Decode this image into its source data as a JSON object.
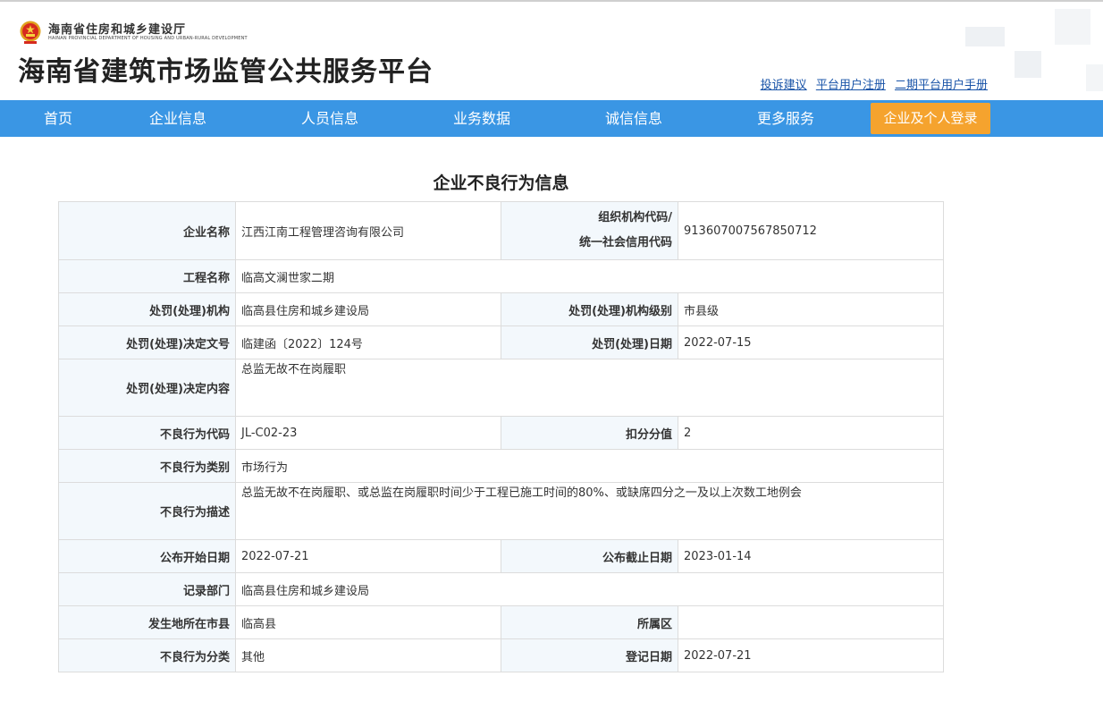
{
  "header": {
    "dept_name_cn": "海南省住房和城乡建设厅",
    "dept_name_en": "HAINAN PROVINCIAL DEPARTMENT OF HOUSING AND URBAN-RURAL DEVELOPMENT",
    "site_title": "海南省建筑市场监管公共服务平台",
    "links": [
      "投诉建议",
      "平台用户注册",
      "二期平台用户手册"
    ],
    "emblem_icon": "national-emblem-icon"
  },
  "nav": {
    "items": [
      "首页",
      "企业信息",
      "人员信息",
      "业务数据",
      "诚信信息",
      "更多服务"
    ],
    "login": "企业及个人登录",
    "bar_color": "#3a96e4",
    "login_color": "#f5a32e"
  },
  "page_title": "企业不良行为信息",
  "record": {
    "company_name_label": "企业名称",
    "company_name": "江西江南工程管理咨询有限公司",
    "org_code_label_1": "组织机构代码/",
    "org_code_label_2": "统一社会信用代码",
    "org_code": "913607007567850712",
    "project_name_label": "工程名称",
    "project_name": "临高文澜世家二期",
    "penalty_org_label": "处罚(处理)机构",
    "penalty_org": "临高县住房和城乡建设局",
    "penalty_level_label": "处罚(处理)机构级别",
    "penalty_level": "市县级",
    "decision_no_label": "处罚(处理)决定文号",
    "decision_no": "临建函〔2022〕124号",
    "penalty_date_label": "处罚(处理)日期",
    "penalty_date": "2022-07-15",
    "decision_content_label": "处罚(处理)决定内容",
    "decision_content": "总监无故不在岗履职",
    "behavior_code_label": "不良行为代码",
    "behavior_code": "JL-C02-23",
    "deduct_label": "扣分分值",
    "deduct": "2",
    "behavior_type_label": "不良行为类别",
    "behavior_type": "市场行为",
    "behavior_desc_label": "不良行为描述",
    "behavior_desc": "总监无故不在岗履职、或总监在岗履职时间少于工程已施工时间的80%、或缺席四分之一及以上次数工地例会",
    "publish_start_label": "公布开始日期",
    "publish_start": "2022-07-21",
    "publish_end_label": "公布截止日期",
    "publish_end": "2023-01-14",
    "record_dept_label": "记录部门",
    "record_dept": "临高县住房和城乡建设局",
    "city_label": "发生地所在市县",
    "city": "临高县",
    "district_label": "所属区",
    "district": "",
    "category_label": "不良行为分类",
    "category": "其他",
    "register_date_label": "登记日期",
    "register_date": "2022-07-21"
  }
}
